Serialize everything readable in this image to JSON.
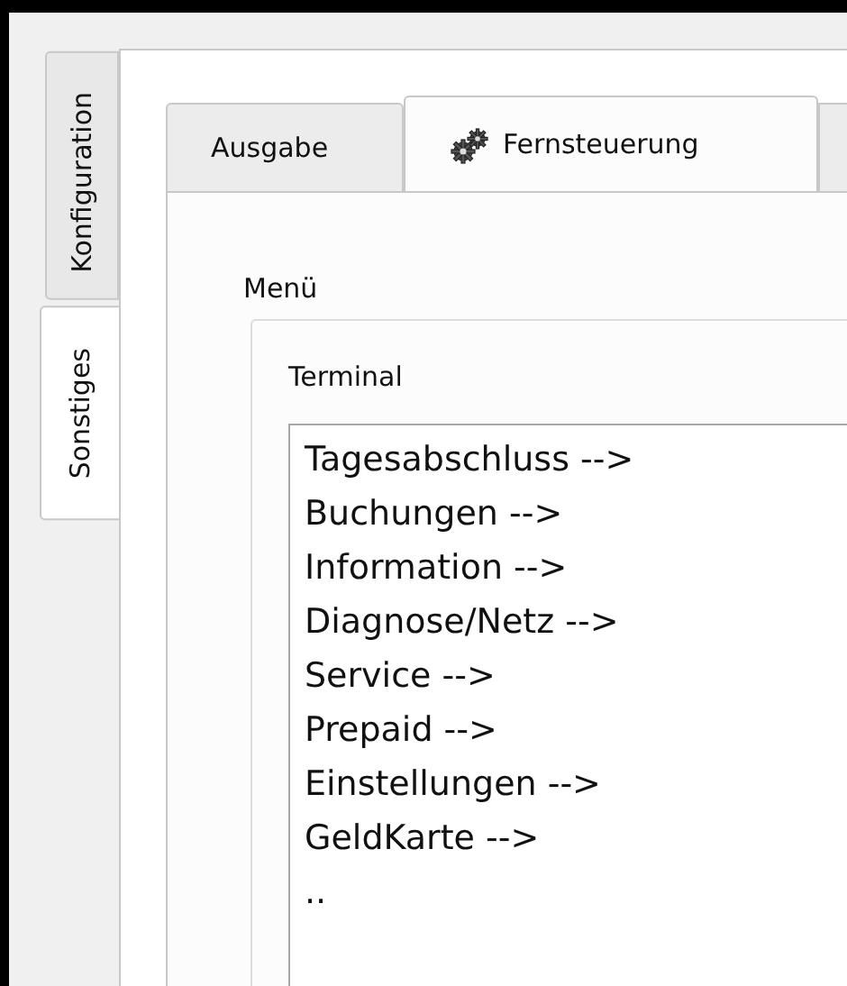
{
  "vertical_tabs": [
    {
      "label": "Konfiguration",
      "selected": false
    },
    {
      "label": "Sonstiges",
      "selected": true
    }
  ],
  "tabs": [
    {
      "label": "Ausgabe",
      "selected": false,
      "has_icon": false
    },
    {
      "label": "Fernsteuerung",
      "selected": true,
      "has_icon": true
    }
  ],
  "group": {
    "title": "Menü",
    "inner_title": "Terminal",
    "items": [
      "Tagesabschluss -->",
      "Buchungen -->",
      "Information -->",
      "Diagnose/Netz -->",
      "Service -->",
      "Prepaid -->",
      "Einstellungen -->",
      "GeldKarte -->",
      ".."
    ]
  }
}
